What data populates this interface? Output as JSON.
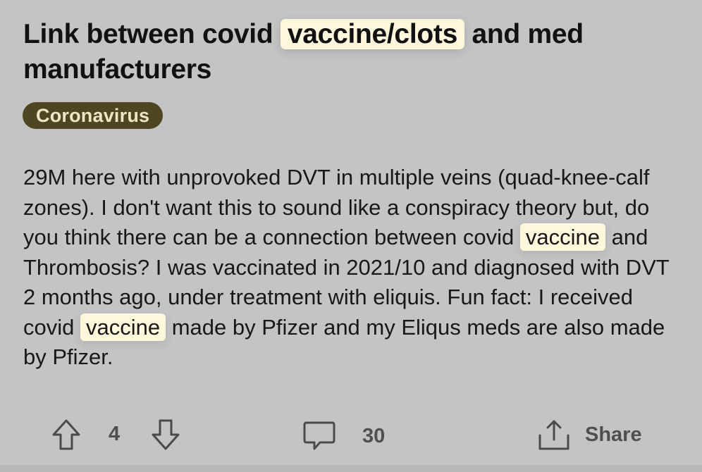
{
  "post": {
    "title_before": "Link between covid ",
    "title_highlight": "vaccine/clots",
    "title_after": " and med manufacturers",
    "flair": "Coronavirus",
    "body_part1": "29M here with unprovoked DVT in multiple veins (quad-knee-calf zones). I don't want this to sound like a conspiracy theory but, do you think there can be a connection between covid ",
    "body_highlight1": "vaccine",
    "body_part2": " and Thrombosis? I was vaccinated in 2021/10 and diagnosed with DVT 2 months ago, under treatment with eliquis. Fun fact: I received covid ",
    "body_highlight2": "vaccine",
    "body_part3": " made by Pfizer and my Eliqus meds are also made by Pfizer."
  },
  "actions": {
    "upvote_icon": "arrow-up-icon",
    "vote_count": "4",
    "downvote_icon": "arrow-down-icon",
    "comment_icon": "comment-icon",
    "comment_count": "30",
    "share_icon": "share-icon",
    "share_label": "Share"
  },
  "colors": {
    "background": "#c4c4c4",
    "highlight": "#fff7dc",
    "flair_bg": "#4e4521",
    "flair_text": "#ece5c8",
    "action_gray": "#4f4f4f"
  }
}
